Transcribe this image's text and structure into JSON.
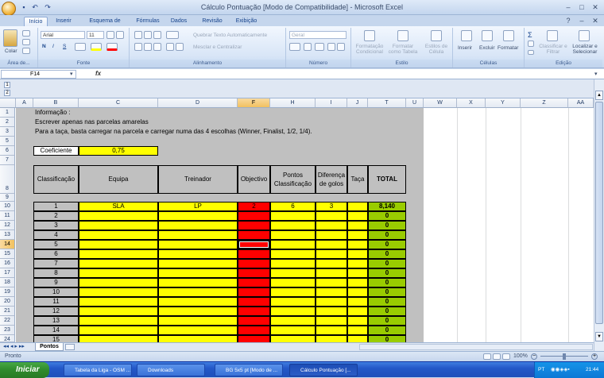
{
  "window": {
    "title": "Cálculo Pontuação  [Modo de Compatibilidade] - Microsoft Excel",
    "minimize": "–",
    "maximize": "□",
    "close": "✕"
  },
  "ribbon_tabs": [
    "Início",
    "Inserir",
    "Esquema de Página",
    "Fórmulas",
    "Dados",
    "Revisão",
    "Exibição"
  ],
  "ribbon": {
    "clipboard": {
      "label": "Área de...",
      "paste": "Colar"
    },
    "font": {
      "label": "Fonte",
      "name": "Arial",
      "size": "11",
      "bold": "N",
      "italic": "I",
      "underline": "S"
    },
    "alignment": {
      "label": "Alinhamento",
      "wrap": "Quebrar Texto Automaticamente",
      "merge": "Mesclar e Centralizar"
    },
    "number": {
      "label": "Número",
      "format": "Geral"
    },
    "styles": {
      "label": "Estilo",
      "cond": "Formatação Condicional",
      "table": "Formatar como Tabela",
      "cell": "Estilos de Célula"
    },
    "cells": {
      "label": "Células",
      "insert": "Inserir",
      "delete": "Excluir",
      "format": "Formatar"
    },
    "editing": {
      "label": "Edição",
      "sort": "Classificar e Filtrar",
      "find": "Localizar e Selecionar"
    }
  },
  "formula_bar": {
    "cell_ref": "F14",
    "fx": "fx",
    "value": ""
  },
  "outline_levels": [
    "1",
    "2"
  ],
  "columns": [
    "A",
    "B",
    "C",
    "D",
    "F",
    "H",
    "I",
    "J",
    "T",
    "U",
    "W",
    "X",
    "Y",
    "Z",
    "AA"
  ],
  "selected_column": "F",
  "rows": [
    "1",
    "2",
    "3",
    "5",
    "6",
    "7",
    "8",
    "9",
    "10",
    "11",
    "12",
    "13",
    "14",
    "15",
    "16",
    "17",
    "18",
    "19",
    "20",
    "21",
    "22",
    "23",
    "24"
  ],
  "selected_row": "14",
  "info": {
    "line1": "Informação :",
    "line2": "Escrever apenas nas parcelas amarelas",
    "line3": "Para a taça, basta carregar na parcela e carregar numa das 4 escolhas (Winner, Finalist, 1/2, 1/4)."
  },
  "coefficient": {
    "label": "Coeficiente",
    "value": "0,75"
  },
  "table_headers": {
    "classificacao": "Classificação",
    "equipa": "Equipa",
    "treinador": "Treinador",
    "objectivo": "Objectivo",
    "pontos": "Pontos Classificação",
    "diferenca": "Diferença de golos",
    "taca": "Taça",
    "total": "TOTAL"
  },
  "table_rows": [
    {
      "pos": "1",
      "equipa": "SLA",
      "treinador": "LP",
      "objectivo": "2",
      "pontos": "6",
      "diferenca": "3",
      "taca": "",
      "total": "8,140"
    },
    {
      "pos": "2",
      "equipa": "",
      "treinador": "",
      "objectivo": "",
      "pontos": "",
      "diferenca": "",
      "taca": "",
      "total": "0"
    },
    {
      "pos": "3",
      "equipa": "",
      "treinador": "",
      "objectivo": "",
      "pontos": "",
      "diferenca": "",
      "taca": "",
      "total": "0"
    },
    {
      "pos": "4",
      "equipa": "",
      "treinador": "",
      "objectivo": "",
      "pontos": "",
      "diferenca": "",
      "taca": "",
      "total": "0"
    },
    {
      "pos": "5",
      "equipa": "",
      "treinador": "",
      "objectivo": "",
      "pontos": "",
      "diferenca": "",
      "taca": "",
      "total": "0"
    },
    {
      "pos": "6",
      "equipa": "",
      "treinador": "",
      "objectivo": "",
      "pontos": "",
      "diferenca": "",
      "taca": "",
      "total": "0"
    },
    {
      "pos": "7",
      "equipa": "",
      "treinador": "",
      "objectivo": "",
      "pontos": "",
      "diferenca": "",
      "taca": "",
      "total": "0"
    },
    {
      "pos": "8",
      "equipa": "",
      "treinador": "",
      "objectivo": "",
      "pontos": "",
      "diferenca": "",
      "taca": "",
      "total": "0"
    },
    {
      "pos": "9",
      "equipa": "",
      "treinador": "",
      "objectivo": "",
      "pontos": "",
      "diferenca": "",
      "taca": "",
      "total": "0"
    },
    {
      "pos": "10",
      "equipa": "",
      "treinador": "",
      "objectivo": "",
      "pontos": "",
      "diferenca": "",
      "taca": "",
      "total": "0"
    },
    {
      "pos": "11",
      "equipa": "",
      "treinador": "",
      "objectivo": "",
      "pontos": "",
      "diferenca": "",
      "taca": "",
      "total": "0"
    },
    {
      "pos": "12",
      "equipa": "",
      "treinador": "",
      "objectivo": "",
      "pontos": "",
      "diferenca": "",
      "taca": "",
      "total": "0"
    },
    {
      "pos": "13",
      "equipa": "",
      "treinador": "",
      "objectivo": "",
      "pontos": "",
      "diferenca": "",
      "taca": "",
      "total": "0"
    },
    {
      "pos": "14",
      "equipa": "",
      "treinador": "",
      "objectivo": "",
      "pontos": "",
      "diferenca": "",
      "taca": "",
      "total": "0"
    },
    {
      "pos": "15",
      "equipa": "",
      "treinador": "",
      "objectivo": "",
      "pontos": "",
      "diferenca": "",
      "taca": "",
      "total": "0"
    }
  ],
  "sheet_tab": "Pontos",
  "status": {
    "ready": "Pronto",
    "zoom": "100%"
  },
  "taskbar": {
    "start": "Iniciar",
    "items": [
      "Tabela da Liga - OSM ...",
      "Downloads",
      "BG 5x5 pt [Modo de ...",
      "Cálculo Pontuação [..."
    ],
    "lang": "PT",
    "time": "21:44"
  },
  "colors": {
    "yellow": "#ffff00",
    "red": "#ff0000",
    "green": "#99cc00",
    "gray": "#c0c0c0",
    "selection": "#f1c15f"
  }
}
